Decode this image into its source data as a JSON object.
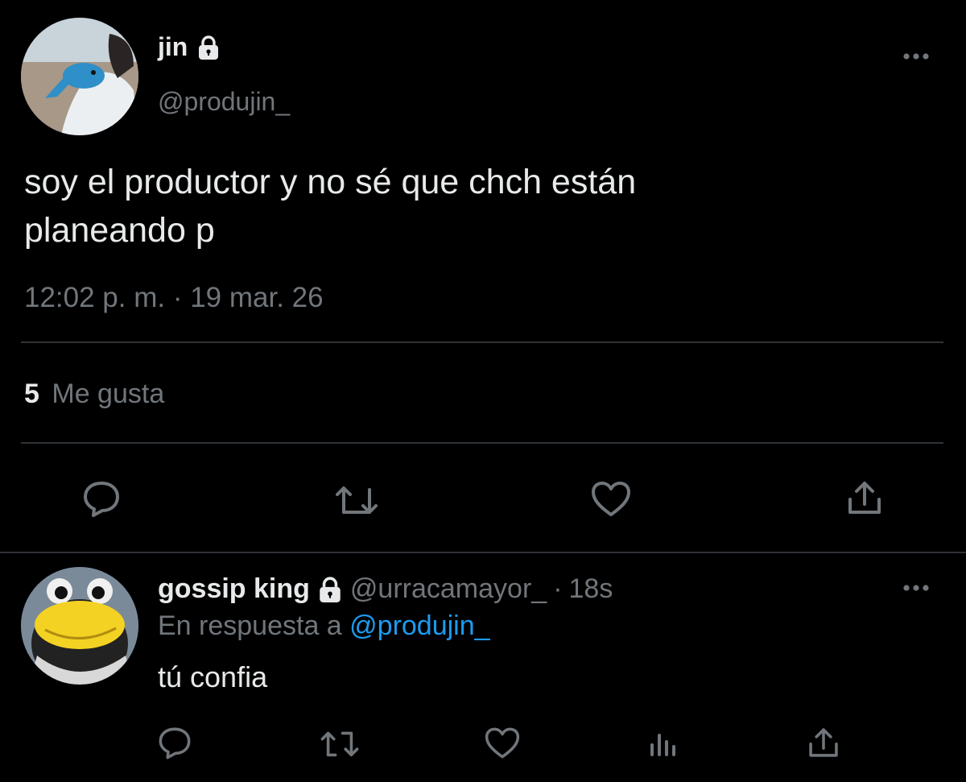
{
  "main_tweet": {
    "author_name": "jin",
    "author_handle": "@produjin_",
    "protected_icon": "lock-icon",
    "text_line1": "soy el productor y no sé que chch están",
    "text_line2": "planeando p",
    "timestamp": "12:02 p. m. · 19 mar. 26",
    "likes_count": "5",
    "likes_label": "Me gusta",
    "more_icon": "more-options-icon"
  },
  "reply": {
    "author_name": "gossip king",
    "author_handle": "@urracamayor_",
    "separator": "·",
    "time": "18s",
    "reply_prefix": "En respuesta a",
    "reply_to": "@produjin_",
    "text": "tú confia",
    "more_icon": "more-options-icon"
  },
  "actions": {
    "reply_icon": "reply-icon",
    "retweet_icon": "retweet-icon",
    "like_icon": "heart-icon",
    "analytics_icon": "analytics-icon",
    "share_icon": "share-icon"
  },
  "colors": {
    "background": "#000000",
    "text": "#e7e9ea",
    "muted": "#71767b",
    "link": "#1d9bf0",
    "divider": "#2f3336"
  }
}
